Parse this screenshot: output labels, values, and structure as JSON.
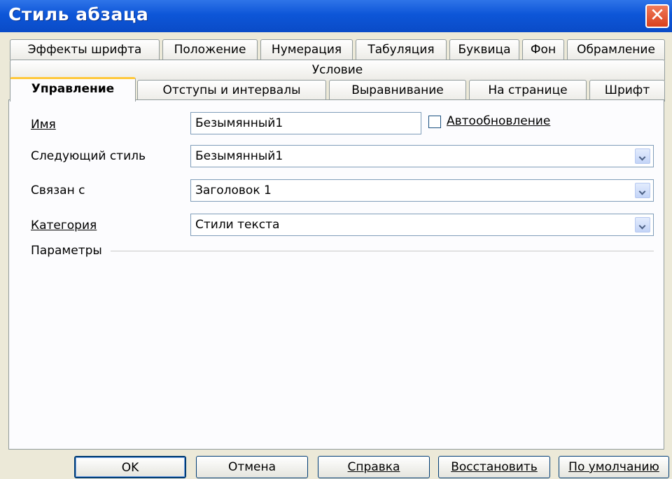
{
  "window": {
    "title": "Стиль абзаца",
    "close_glyph": "✕"
  },
  "tabs": {
    "row1": [
      "Эффекты шрифта",
      "Положение",
      "Нумерация",
      "Табуляция",
      "Буквица",
      "Фон",
      "Обрамление"
    ],
    "row2": [
      "Условие"
    ],
    "row3": [
      "Управление",
      "Отступы и интервалы",
      "Выравнивание",
      "На странице",
      "Шрифт"
    ],
    "active": "Управление"
  },
  "form": {
    "name_label": "Имя",
    "name_value": "Безымянный1",
    "autoupdate_label": "Автообновление",
    "autoupdate_checked": false,
    "next_style_label": "Следующий стиль",
    "next_style_value": "Безымянный1",
    "linked_label": "Связан с",
    "linked_value": "Заголовок 1",
    "category_label": "Категория",
    "category_value": "Стили текста",
    "params_label": "Параметры"
  },
  "buttons": {
    "ok": "OK",
    "cancel": "Отмена",
    "help": "Справка",
    "reset": "Восстановить",
    "default": "По умолчанию"
  },
  "icons": {
    "close": "close-icon",
    "dropdown": "chevron-down-icon"
  },
  "colors": {
    "titlebar": "#0d56d8",
    "active_tab_accent": "#ffc83c",
    "dialog_bg": "#ece9d8"
  }
}
